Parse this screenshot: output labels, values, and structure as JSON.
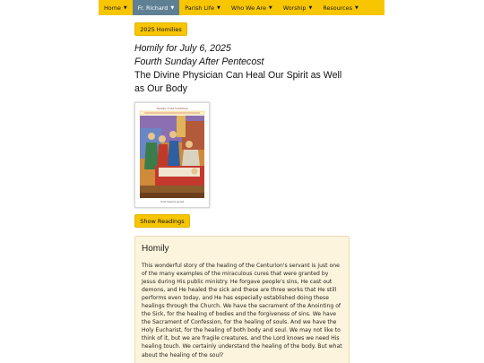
{
  "nav": {
    "items": [
      {
        "label": "Home",
        "active": false
      },
      {
        "label": "Fr. Richard",
        "active": true
      },
      {
        "label": "Parish Life",
        "active": false
      },
      {
        "label": "Who We Are",
        "active": false
      },
      {
        "label": "Worship",
        "active": false
      },
      {
        "label": "Resources",
        "active": false
      }
    ],
    "caret": "▼",
    "bar_color": "#f7c600",
    "active_color": "#5f7f94"
  },
  "tag_button": {
    "label": "2025 Homilies"
  },
  "heading": {
    "date_line": "Homily for July 6, 2025",
    "occasion_line": "Fourth Sunday After Pentecost",
    "title": "The Divine Physician Can Heal Our Spirit as Well as Our Body"
  },
  "cover": {
    "top_line": "Sunday of the Centurion",
    "caption": "Christ heals the servant",
    "image_subject": "icon-of-christ-healing"
  },
  "readings_button": {
    "label": "Show Readings"
  },
  "homily": {
    "heading": "Homily",
    "body": "This wonderful story of the healing of the Centurion's servant is just one of the many examples of the miraculous cures that were granted by Jesus during His public ministry. He forgave people's sins, He cast out demons, and He healed the sick and these are three works that He still performs even today, and He has especially established doing these healings through the Church. We have the sacrament of the Anointing of the Sick, for the healing of bodies and the forgiveness of sins. We have the Sacrament of Confession, for the healing of souls. And we have the Holy Eucharist, for the healing of both body and soul. We may not like to think of it, but we are fragile creatures, and the Lord knows we need His healing touch. We certainly understand the healing of the body. But what about the healing of the soul?"
  }
}
